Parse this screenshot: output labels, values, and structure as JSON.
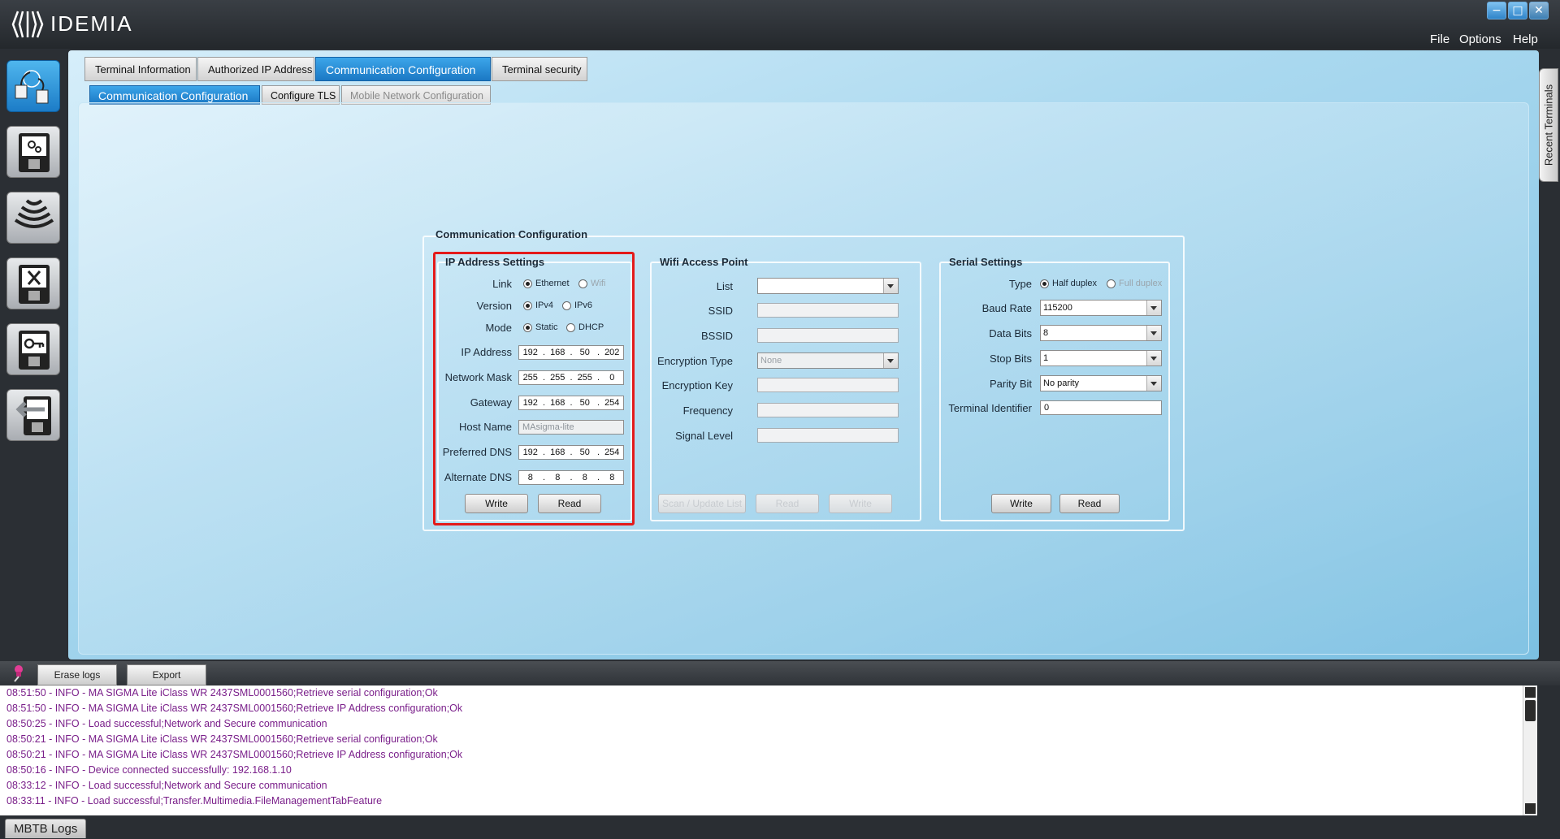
{
  "app": {
    "brand": "IDEMIA"
  },
  "menu": [
    "File",
    "Options",
    "Help"
  ],
  "window_controls": {
    "minimize": "−",
    "maximize": "□",
    "close": "✕"
  },
  "tabs": [
    {
      "label": "Terminal Information",
      "active": false
    },
    {
      "label": "Authorized IP Address",
      "active": false
    },
    {
      "label": "Communication Configuration",
      "active": true
    },
    {
      "label": "Terminal security",
      "active": false
    }
  ],
  "subtabs": [
    {
      "label": "Communication Configuration",
      "active": true
    },
    {
      "label": "Configure TLS",
      "active": false
    },
    {
      "label": "Mobile Network Configuration",
      "active": false,
      "disabled": true
    }
  ],
  "side_panel": {
    "label": "Recent Terminals"
  },
  "sidebar_icons": [
    "network-config-icon",
    "terminal-settings-icon",
    "wireless-icon",
    "tools-icon",
    "key-icon",
    "import-icon"
  ],
  "comm": {
    "title": "Communication Configuration",
    "ip": {
      "title": "IP Address Settings",
      "link_label": "Link",
      "link_options": [
        "Ethernet",
        "Wifi"
      ],
      "version_label": "Version",
      "version_options": [
        "IPv4",
        "IPv6"
      ],
      "mode_label": "Mode",
      "mode_options": [
        "Static",
        "DHCP"
      ],
      "ip_label": "IP Address",
      "ip_value": [
        "192",
        "168",
        "50",
        "202"
      ],
      "mask_label": "Network Mask",
      "mask_value": [
        "255",
        "255",
        "255",
        "0"
      ],
      "gateway_label": "Gateway",
      "gateway_value": [
        "192",
        "168",
        "50",
        "254"
      ],
      "host_label": "Host Name",
      "host_value": "MAsigma-lite",
      "pdns_label": "Preferred DNS",
      "pdns_value": [
        "192",
        "168",
        "50",
        "254"
      ],
      "adns_label": "Alternate DNS",
      "adns_value": [
        "8",
        "8",
        "8",
        "8"
      ],
      "write": "Write",
      "read": "Read"
    },
    "wifi": {
      "title": "Wifi Access Point",
      "list_label": "List",
      "ssid_label": "SSID",
      "bssid_label": "BSSID",
      "enc_type_label": "Encryption Type",
      "enc_type_value": "None",
      "enc_key_label": "Encryption Key",
      "freq_label": "Frequency",
      "signal_label": "Signal Level",
      "scan": "Scan / Update List",
      "read": "Read",
      "write": "Write"
    },
    "serial": {
      "title": "Serial Settings",
      "type_label": "Type",
      "type_options": [
        "Half duplex",
        "Full duplex"
      ],
      "baud_label": "Baud Rate",
      "baud_value": "115200",
      "data_label": "Data Bits",
      "data_value": "8",
      "stop_label": "Stop Bits",
      "stop_value": "1",
      "parity_label": "Parity Bit",
      "parity_value": "No parity",
      "tid_label": "Terminal Identifier",
      "tid_value": "0",
      "write": "Write",
      "read": "Read"
    }
  },
  "logs": {
    "erase": "Erase logs",
    "export": "Export",
    "lines": [
      "08:51:50 - INFO - MA SIGMA Lite iClass WR 2437SML0001560;Retrieve serial configuration;Ok",
      "08:51:50 - INFO - MA SIGMA Lite iClass WR 2437SML0001560;Retrieve IP Address configuration;Ok",
      "08:50:25 - INFO - Load successful;Network and Secure communication",
      "08:50:21 - INFO - MA SIGMA Lite iClass WR 2437SML0001560;Retrieve serial configuration;Ok",
      "08:50:21 - INFO - MA SIGMA Lite iClass WR 2437SML0001560;Retrieve IP Address configuration;Ok",
      "08:50:16 - INFO - Device connected successfully: 192.168.1.10",
      "08:33:12 - INFO - Load successful;Network and Secure communication",
      "08:33:11 - INFO - Load successful;Transfer.Multimedia.FileManagementTabFeature"
    ],
    "tab": "MBTB Logs"
  },
  "colors": {
    "accent": "#1b78c4",
    "highlight": "#e41a1a",
    "log_text": "#7a1f8a"
  }
}
